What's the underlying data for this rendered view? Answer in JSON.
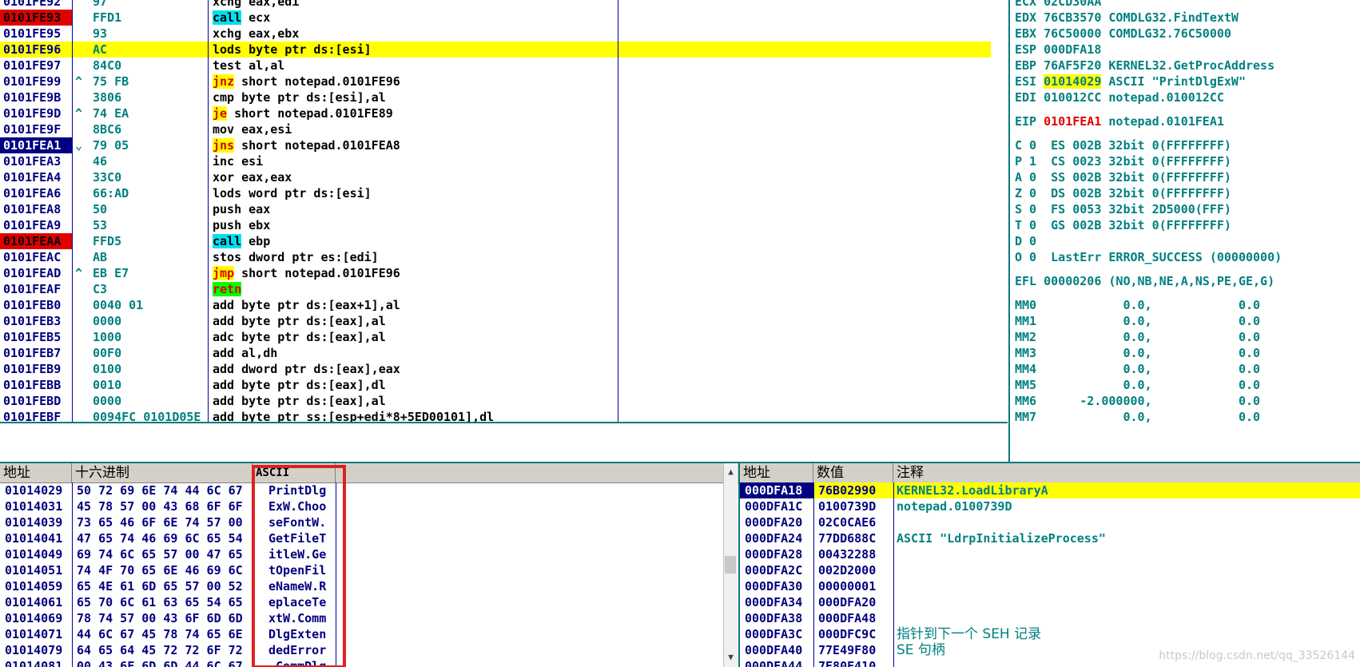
{
  "colors": {
    "bp_red": "#e00000",
    "eip_navy": "#000080",
    "highlight_yellow": "#ffff00",
    "call_cyan": "#00e0f0",
    "retn_green": "#00ff00",
    "jmp_yellow": "#ffff00",
    "addr_blue": "#000080",
    "reg_teal": "#008080"
  },
  "disasm": {
    "rows": [
      {
        "addr": "0101FE92",
        "mark": "",
        "hex": "97",
        "instr": "xchg eax,edi",
        "bp": false,
        "eip": false,
        "hl": false,
        "mn": "xchg",
        "mncolor": ""
      },
      {
        "addr": "0101FE93",
        "mark": "",
        "hex": "FFD1",
        "instr": "call ecx",
        "bp": true,
        "eip": false,
        "hl": false,
        "mn": "call",
        "mncolor": "cyan"
      },
      {
        "addr": "0101FE95",
        "mark": "",
        "hex": "93",
        "instr": "xchg eax,ebx",
        "bp": false,
        "eip": false,
        "hl": false,
        "mn": "xchg",
        "mncolor": ""
      },
      {
        "addr": "0101FE96",
        "mark": "",
        "hex": "AC",
        "instr": "lods byte ptr ds:[esi]",
        "bp": false,
        "eip": false,
        "hl": true,
        "mn": "lods",
        "mncolor": ""
      },
      {
        "addr": "0101FE97",
        "mark": "",
        "hex": "84C0",
        "instr": "test al,al",
        "bp": false,
        "eip": false,
        "hl": false,
        "mn": "test",
        "mncolor": ""
      },
      {
        "addr": "0101FE99",
        "mark": "^",
        "hex": "75 FB",
        "instr": "jnz short notepad.0101FE96",
        "bp": false,
        "eip": false,
        "hl": false,
        "mn": "jnz",
        "mncolor": "yellow"
      },
      {
        "addr": "0101FE9B",
        "mark": "",
        "hex": "3806",
        "instr": "cmp byte ptr ds:[esi],al",
        "bp": false,
        "eip": false,
        "hl": false,
        "mn": "cmp",
        "mncolor": ""
      },
      {
        "addr": "0101FE9D",
        "mark": "^",
        "hex": "74 EA",
        "instr": "je short notepad.0101FE89",
        "bp": false,
        "eip": false,
        "hl": false,
        "mn": "je",
        "mncolor": "yellow"
      },
      {
        "addr": "0101FE9F",
        "mark": "",
        "hex": "8BC6",
        "instr": "mov eax,esi",
        "bp": false,
        "eip": false,
        "hl": false,
        "mn": "mov",
        "mncolor": ""
      },
      {
        "addr": "0101FEA1",
        "mark": "⌄",
        "hex": "79 05",
        "instr": "jns short notepad.0101FEA8",
        "bp": false,
        "eip": true,
        "hl": false,
        "mn": "jns",
        "mncolor": "yellow"
      },
      {
        "addr": "0101FEA3",
        "mark": "",
        "hex": "46",
        "instr": "inc esi",
        "bp": false,
        "eip": false,
        "hl": false,
        "mn": "inc",
        "mncolor": ""
      },
      {
        "addr": "0101FEA4",
        "mark": "",
        "hex": "33C0",
        "instr": "xor eax,eax",
        "bp": false,
        "eip": false,
        "hl": false,
        "mn": "xor",
        "mncolor": ""
      },
      {
        "addr": "0101FEA6",
        "mark": "",
        "hex": "66:AD",
        "instr": "lods word ptr ds:[esi]",
        "bp": false,
        "eip": false,
        "hl": false,
        "mn": "lods",
        "mncolor": ""
      },
      {
        "addr": "0101FEA8",
        "mark": "",
        "hex": "50",
        "instr": "push eax",
        "bp": false,
        "eip": false,
        "hl": false,
        "mn": "push",
        "mncolor": ""
      },
      {
        "addr": "0101FEA9",
        "mark": "",
        "hex": "53",
        "instr": "push ebx",
        "bp": false,
        "eip": false,
        "hl": false,
        "mn": "push",
        "mncolor": ""
      },
      {
        "addr": "0101FEAA",
        "mark": "",
        "hex": "FFD5",
        "instr": "call ebp",
        "bp": true,
        "eip": false,
        "hl": false,
        "mn": "call",
        "mncolor": "cyan"
      },
      {
        "addr": "0101FEAC",
        "mark": "",
        "hex": "AB",
        "instr": "stos dword ptr es:[edi]",
        "bp": false,
        "eip": false,
        "hl": false,
        "mn": "stos",
        "mncolor": ""
      },
      {
        "addr": "0101FEAD",
        "mark": "^",
        "hex": "EB E7",
        "instr": "jmp short notepad.0101FE96",
        "bp": false,
        "eip": false,
        "hl": false,
        "mn": "jmp",
        "mncolor": "yellow"
      },
      {
        "addr": "0101FEAF",
        "mark": "",
        "hex": "C3",
        "instr": "retn",
        "bp": false,
        "eip": false,
        "hl": false,
        "mn": "retn",
        "mncolor": "green"
      },
      {
        "addr": "0101FEB0",
        "mark": "",
        "hex": "0040 01",
        "instr": "add byte ptr ds:[eax+1],al",
        "bp": false,
        "eip": false,
        "hl": false,
        "mn": "add",
        "mncolor": ""
      },
      {
        "addr": "0101FEB3",
        "mark": "",
        "hex": "0000",
        "instr": "add byte ptr ds:[eax],al",
        "bp": false,
        "eip": false,
        "hl": false,
        "mn": "add",
        "mncolor": ""
      },
      {
        "addr": "0101FEB5",
        "mark": "",
        "hex": "1000",
        "instr": "adc byte ptr ds:[eax],al",
        "bp": false,
        "eip": false,
        "hl": false,
        "mn": "adc",
        "mncolor": ""
      },
      {
        "addr": "0101FEB7",
        "mark": "",
        "hex": "00F0",
        "instr": "add al,dh",
        "bp": false,
        "eip": false,
        "hl": false,
        "mn": "add",
        "mncolor": ""
      },
      {
        "addr": "0101FEB9",
        "mark": "",
        "hex": "0100",
        "instr": "add dword ptr ds:[eax],eax",
        "bp": false,
        "eip": false,
        "hl": false,
        "mn": "add",
        "mncolor": ""
      },
      {
        "addr": "0101FEBB",
        "mark": "",
        "hex": "0010",
        "instr": "add byte ptr ds:[eax],dl",
        "bp": false,
        "eip": false,
        "hl": false,
        "mn": "add",
        "mncolor": ""
      },
      {
        "addr": "0101FEBD",
        "mark": "",
        "hex": "0000",
        "instr": "add byte ptr ds:[eax],al",
        "bp": false,
        "eip": false,
        "hl": false,
        "mn": "add",
        "mncolor": ""
      },
      {
        "addr": "0101FEBF",
        "mark": "",
        "hex": "0094FC 0101D05E",
        "instr": "add byte ptr ss:[esp+edi*8+5ED00101],dl",
        "bp": false,
        "eip": false,
        "hl": false,
        "mn": "add",
        "mncolor": ""
      }
    ]
  },
  "registers": {
    "lines": [
      {
        "text": "ECX 02CD30AA",
        "hl": ""
      },
      {
        "text": "EDX 76CB3570 COMDLG32.FindTextW",
        "hl": ""
      },
      {
        "text": "EBX 76C50000 COMDLG32.76C50000",
        "hl": ""
      },
      {
        "text": "ESP 000DFA18",
        "hl": ""
      },
      {
        "text": "EBP 76AF5F20 KERNEL32.GetProcAddress",
        "hl": ""
      },
      {
        "text": "ESI 01014029 ASCII \"PrintDlgExW\"",
        "hl": "yellow"
      },
      {
        "text": "EDI 010012CC notepad.010012CC",
        "hl": ""
      },
      {
        "text": "",
        "hl": ""
      },
      {
        "text": "EIP 0101FEA1 notepad.0101FEA1",
        "hl": "red"
      },
      {
        "text": "",
        "hl": ""
      },
      {
        "text": "C 0  ES 002B 32bit 0(FFFFFFFF)",
        "hl": ""
      },
      {
        "text": "P 1  CS 0023 32bit 0(FFFFFFFF)",
        "hl": ""
      },
      {
        "text": "A 0  SS 002B 32bit 0(FFFFFFFF)",
        "hl": ""
      },
      {
        "text": "Z 0  DS 002B 32bit 0(FFFFFFFF)",
        "hl": ""
      },
      {
        "text": "S 0  FS 0053 32bit 2D5000(FFF)",
        "hl": ""
      },
      {
        "text": "T 0  GS 002B 32bit 0(FFFFFFFF)",
        "hl": ""
      },
      {
        "text": "D 0",
        "hl": ""
      },
      {
        "text": "O 0  LastErr ERROR_SUCCESS (00000000)",
        "hl": ""
      },
      {
        "text": "",
        "hl": ""
      },
      {
        "text": "EFL 00000206 (NO,NB,NE,A,NS,PE,GE,G)",
        "hl": ""
      },
      {
        "text": "",
        "hl": ""
      },
      {
        "text": "MM0            0.0,            0.0",
        "hl": ""
      },
      {
        "text": "MM1            0.0,            0.0",
        "hl": ""
      },
      {
        "text": "MM2            0.0,            0.0",
        "hl": ""
      },
      {
        "text": "MM3            0.0,            0.0",
        "hl": ""
      },
      {
        "text": "MM4            0.0,            0.0",
        "hl": ""
      },
      {
        "text": "MM5            0.0,            0.0",
        "hl": ""
      },
      {
        "text": "MM6      -2.000000,            0.0",
        "hl": ""
      },
      {
        "text": "MM7            0.0,            0.0",
        "hl": ""
      }
    ]
  },
  "dump": {
    "headers": {
      "addr": "地址",
      "hex": "十六进制",
      "ascii": "ASCII"
    },
    "rows": [
      {
        "addr": "01014029",
        "hex": "50 72 69 6E 74 44 6C 67",
        "ascii": "PrintDlg"
      },
      {
        "addr": "01014031",
        "hex": "45 78 57 00 43 68 6F 6F",
        "ascii": "ExW.Choo"
      },
      {
        "addr": "01014039",
        "hex": "73 65 46 6F 6E 74 57 00",
        "ascii": "seFontW."
      },
      {
        "addr": "01014041",
        "hex": "47 65 74 46 69 6C 65 54",
        "ascii": "GetFileT"
      },
      {
        "addr": "01014049",
        "hex": "69 74 6C 65 57 00 47 65",
        "ascii": "itleW.Ge"
      },
      {
        "addr": "01014051",
        "hex": "74 4F 70 65 6E 46 69 6C",
        "ascii": "tOpenFil"
      },
      {
        "addr": "01014059",
        "hex": "65 4E 61 6D 65 57 00 52",
        "ascii": "eNameW.R"
      },
      {
        "addr": "01014061",
        "hex": "65 70 6C 61 63 65 54 65",
        "ascii": "eplaceTe"
      },
      {
        "addr": "01014069",
        "hex": "78 74 57 00 43 6F 6D 6D",
        "ascii": "xtW.Comm"
      },
      {
        "addr": "01014071",
        "hex": "44 6C 67 45 78 74 65 6E",
        "ascii": "DlgExten"
      },
      {
        "addr": "01014079",
        "hex": "64 65 64 45 72 72 6F 72",
        "ascii": "dedError"
      },
      {
        "addr": "01014081",
        "hex": "00 43 6F 6D 6D 44 6C 67",
        "ascii": ".CommDlg"
      }
    ]
  },
  "stack": {
    "headers": {
      "addr": "地址",
      "value": "数值",
      "comment": "注释"
    },
    "rows": [
      {
        "addr": "000DFA18",
        "value": "76B02990",
        "comment": "KERNEL32.LoadLibraryA",
        "sel": true,
        "cjk": false
      },
      {
        "addr": "000DFA1C",
        "value": "0100739D",
        "comment": "notepad.0100739D",
        "sel": false,
        "cjk": false
      },
      {
        "addr": "000DFA20",
        "value": "02C0CAE6",
        "comment": "",
        "sel": false,
        "cjk": false
      },
      {
        "addr": "000DFA24",
        "value": "77DD688C",
        "comment": "ASCII \"LdrpInitializeProcess\"",
        "sel": false,
        "cjk": false
      },
      {
        "addr": "000DFA28",
        "value": "00432288",
        "comment": "",
        "sel": false,
        "cjk": false
      },
      {
        "addr": "000DFA2C",
        "value": "002D2000",
        "comment": "",
        "sel": false,
        "cjk": false
      },
      {
        "addr": "000DFA30",
        "value": "00000001",
        "comment": "",
        "sel": false,
        "cjk": false
      },
      {
        "addr": "000DFA34",
        "value": "000DFA20",
        "comment": "",
        "sel": false,
        "cjk": false
      },
      {
        "addr": "000DFA38",
        "value": "000DFA48",
        "comment": "",
        "sel": false,
        "cjk": false
      },
      {
        "addr": "000DFA3C",
        "value": "000DFC9C",
        "comment": "指针到下一个 SEH 记录",
        "sel": false,
        "cjk": true
      },
      {
        "addr": "000DFA40",
        "value": "77E49F80",
        "comment": "SE 句柄",
        "sel": false,
        "cjk": true
      },
      {
        "addr": "000DFA44",
        "value": "7E80E410",
        "comment": "",
        "sel": false,
        "cjk": false
      }
    ]
  },
  "watermark": "https://blog.csdn.net/qq_33526144"
}
